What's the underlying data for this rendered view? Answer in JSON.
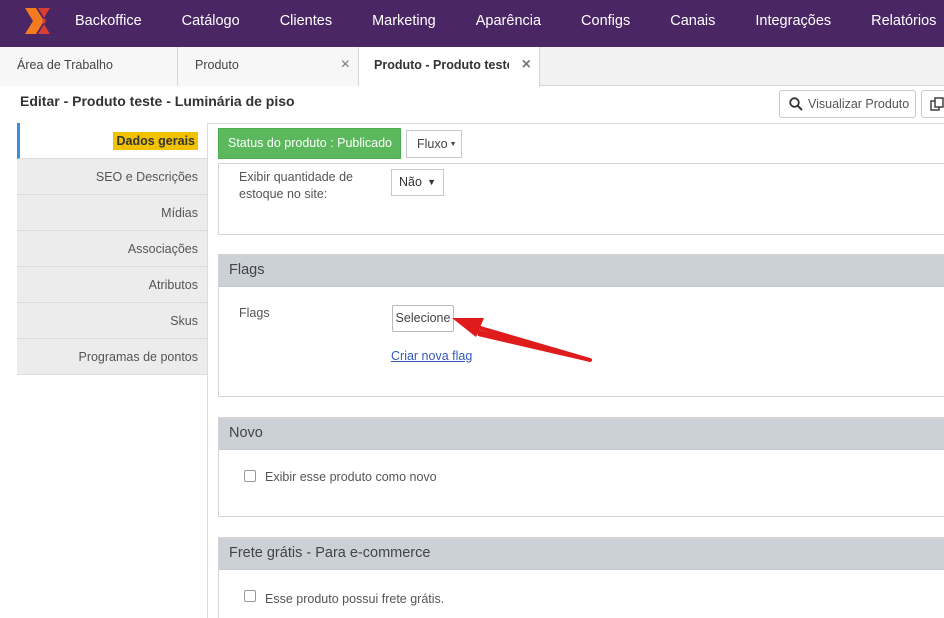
{
  "nav": {
    "items": [
      "Backoffice",
      "Catálogo",
      "Clientes",
      "Marketing",
      "Aparência",
      "Configs",
      "Canais",
      "Integrações",
      "Relatórios"
    ],
    "background": "#4a2665"
  },
  "tabs": [
    {
      "label": "Área de Trabalho"
    },
    {
      "label": "Produto",
      "close": "×"
    },
    {
      "label": "Produto - Produto teste",
      "close": "×"
    }
  ],
  "page": {
    "title": "Editar - Produto teste - Luminária de piso",
    "view_button": "Visualizar Produto"
  },
  "sidebar": {
    "items": [
      "Dados gerais",
      "SEO e Descrições",
      "Mídias",
      "Associações",
      "Atributos",
      "Skus",
      "Programas de pontos"
    ],
    "active_highlight": "#f2c200"
  },
  "status": {
    "label": "Status do produto : Publicado",
    "color": "#5cb85c",
    "fluxo": "Fluxo"
  },
  "stock": {
    "label": "Exibir quantidade de estoque no site:",
    "value": "Não"
  },
  "flags": {
    "title": "Flags",
    "label": "Flags",
    "select_button": "Selecione",
    "new_flag_link": "Criar nova flag"
  },
  "novo": {
    "title": "Novo",
    "checkbox_label": "Exibir esse produto como novo"
  },
  "frete": {
    "title": "Frete grátis - Para e-commerce",
    "checkbox_label": "Esse produto possui frete grátis."
  }
}
